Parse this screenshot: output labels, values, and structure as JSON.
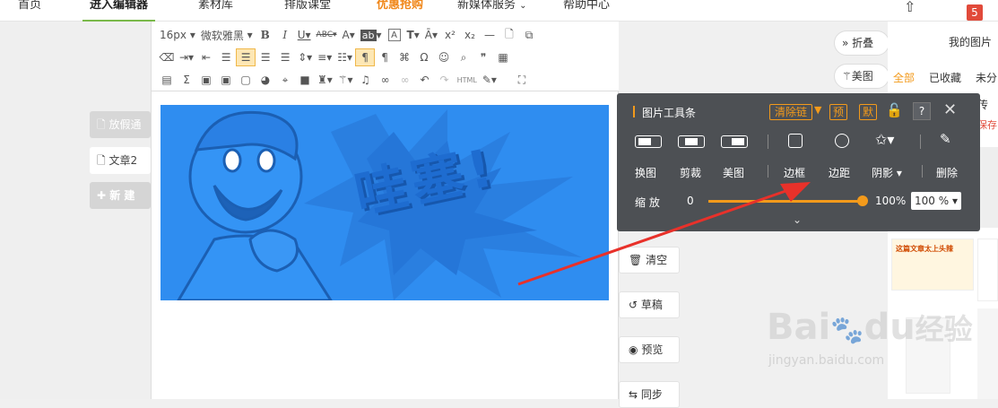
{
  "nav": {
    "home": "首页",
    "editor": "进入编辑器",
    "materials": "素材库",
    "layout_class": "排版课堂",
    "deals": "优惠抢购",
    "media_service": "新媒体服务",
    "help": "帮助中心",
    "badge_count": "5"
  },
  "left": {
    "holiday_notice": "放假通",
    "article2": "文章2",
    "new_label": "新 建"
  },
  "toolbar": {
    "font_size": "16px",
    "font_family": "微软雅黑",
    "bold": "B",
    "italic": "I",
    "underline": "U",
    "strike": "ABC",
    "font_color": "A",
    "bg_color": "ab",
    "border_text": "A",
    "text_style": "T",
    "sup": "x²",
    "sub": "x₂",
    "omega": "Ω",
    "html": "HTML"
  },
  "image": {
    "caption_text": "哇塞!"
  },
  "right_tools": {
    "clear": "清空",
    "draft": "草稿",
    "preview": "预览",
    "sync": "同步"
  },
  "img_toolbar": {
    "title": "图片工具条",
    "clear_chain": "清除链",
    "preset": "预",
    "default": "默",
    "replace": "换图",
    "crop": "剪裁",
    "beautify": "美图",
    "border": "边框",
    "padding": "边距",
    "shadow": "阴影",
    "delete": "删除",
    "zoom_label": "缩 放",
    "zoom_min": "0",
    "zoom_value": "100%",
    "zoom_select": "100 %",
    "zoom_fraction": 1.0
  },
  "right_panel": {
    "fold": "折叠",
    "meitu": "美图",
    "my_images": "我的图片",
    "tab_all": "全部",
    "tab_saved": "已收藏",
    "tab_unsorted": "未分",
    "upload": "传",
    "save_text": "保存",
    "sticker_text": "这篇文章太上头辣"
  },
  "colors": {
    "accent_green": "#7ab94a",
    "orange": "#f39a1b",
    "toolbar_dark": "#4d5054",
    "image_blue": "#2f8df0",
    "arrow_red": "#e8312a"
  },
  "watermark": {
    "brand": "Bai",
    "brand2": "du",
    "cn": "经验",
    "url": "jingyan.baidu.com"
  }
}
